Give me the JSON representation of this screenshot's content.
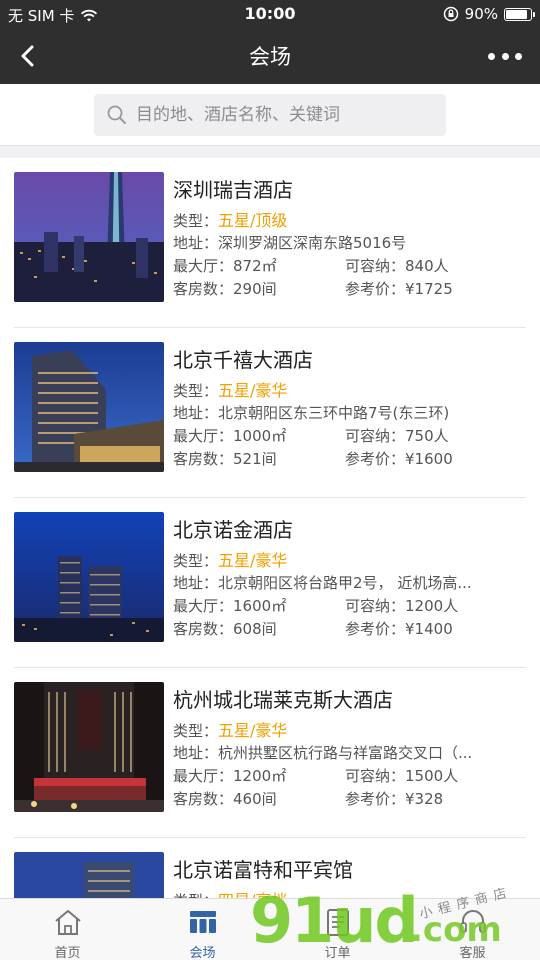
{
  "status_bar": {
    "carrier": "无 SIM 卡",
    "time": "10:00",
    "battery": "90%",
    "battery_level": 0.9
  },
  "nav": {
    "title": "会场"
  },
  "search": {
    "placeholder": "目的地、酒店名称、关键词"
  },
  "labels": {
    "type": "类型：",
    "address": "地址：",
    "max_hall": "最大厅：",
    "capacity": "可容纳：",
    "rooms": "客房数：",
    "price": "参考价："
  },
  "hotels": [
    {
      "name": "深圳瑞吉酒店",
      "type": "五星/顶级",
      "address": "深圳罗湖区深南东路5016号",
      "max_hall": "872㎡",
      "capacity": "840人",
      "rooms": "290间",
      "price": "¥1725"
    },
    {
      "name": "北京千禧大酒店",
      "type": "五星/豪华",
      "address": "北京朝阳区东三环中路7号(东三环)",
      "max_hall": "1000㎡",
      "capacity": "750人",
      "rooms": "521间",
      "price": "¥1600"
    },
    {
      "name": "北京诺金酒店",
      "type": "五星/豪华",
      "address": "北京朝阳区将台路甲2号， 近机场高...",
      "max_hall": "1600㎡",
      "capacity": "1200人",
      "rooms": "608间",
      "price": "¥1400"
    },
    {
      "name": "杭州城北瑞莱克斯大酒店",
      "type": "五星/豪华",
      "address": "杭州拱墅区杭行路与祥富路交叉口（...",
      "max_hall": "1200㎡",
      "capacity": "1500人",
      "rooms": "460间",
      "price": "¥328"
    },
    {
      "name": "北京诺富特和平宾馆",
      "type": "四星/高档",
      "address": "",
      "max_hall": "",
      "capacity": "",
      "rooms": "",
      "price": ""
    }
  ],
  "tabs": [
    {
      "label": "首页",
      "icon": "home-icon",
      "active": false
    },
    {
      "label": "会场",
      "icon": "venue-icon",
      "active": true
    },
    {
      "label": "订单",
      "icon": "order-icon",
      "active": false
    },
    {
      "label": "客服",
      "icon": "service-icon",
      "active": false
    }
  ],
  "watermark": {
    "text": "91ud",
    "suffix": ".com",
    "tagline": "小程序商店"
  },
  "colors": {
    "bar_bg": "#2f2f2f",
    "star_text": "#f0a000",
    "tab_active": "#3264a8"
  }
}
